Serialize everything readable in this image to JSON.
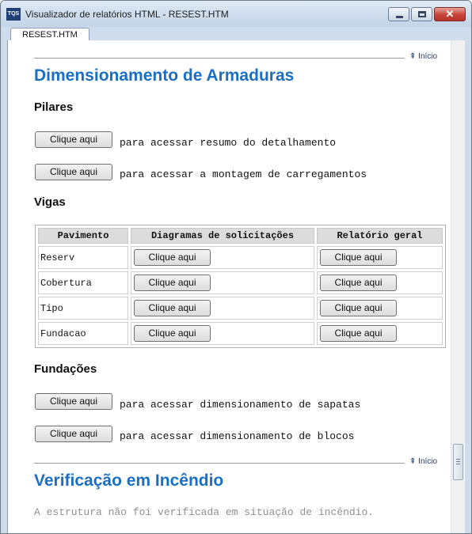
{
  "window": {
    "title": "Visualizador de relatórios HTML - RESEST.HTM",
    "icon_text": "TQS",
    "close_glyph": "✕",
    "tab_label": "RESEST.HTM"
  },
  "nav": {
    "inicio_label": "Início",
    "inicio_glyph": "⇞"
  },
  "armaduras": {
    "title": "Dimensionamento de Armaduras",
    "pilares": {
      "heading": "Pilares",
      "button": "Clique aqui",
      "resumo_text": "para acessar resumo do detalhamento",
      "montagem_text": "para acessar a montagem de carregamentos"
    },
    "vigas": {
      "heading": "Vigas",
      "table": {
        "headers": [
          "Pavimento",
          "Diagramas de solicitações",
          "Relatório geral"
        ],
        "rows": [
          {
            "pavimento": "Reserv",
            "diag": "Clique aqui",
            "rel": "Clique aqui"
          },
          {
            "pavimento": "Cobertura",
            "diag": "Clique aqui",
            "rel": "Clique aqui"
          },
          {
            "pavimento": "Tipo",
            "diag": "Clique aqui",
            "rel": "Clique aqui"
          },
          {
            "pavimento": "Fundacao",
            "diag": "Clique aqui",
            "rel": "Clique aqui"
          }
        ]
      }
    },
    "fundacoes": {
      "heading": "Fundações",
      "button": "Clique aqui",
      "sapatas_text": "para acessar dimensionamento de sapatas",
      "blocos_text": "para acessar dimensionamento de blocos"
    }
  },
  "incendio": {
    "title": "Verificação em Incêndio",
    "text": "A estrutura não foi verificada em situação de incêndio."
  }
}
